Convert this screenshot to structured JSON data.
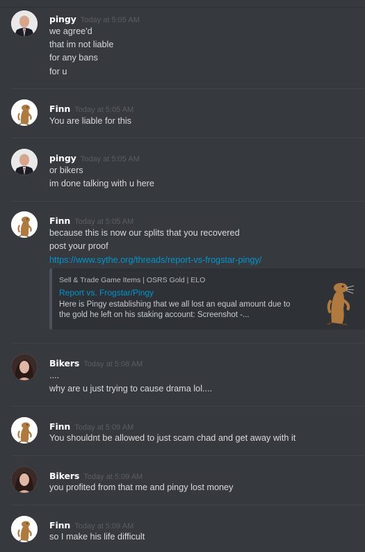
{
  "messages": [
    {
      "author": "pingy",
      "avatar_icon": "man-in-suit-avatar",
      "timestamp": "Today at 5:05 AM",
      "lines": [
        "we agree'd",
        "that im not liable",
        "for any bans",
        "for u"
      ]
    },
    {
      "author": "Finn",
      "avatar_icon": "otter-avatar",
      "timestamp": "Today at 5:05 AM",
      "lines": [
        "You are liable for this"
      ]
    },
    {
      "author": "pingy",
      "avatar_icon": "man-in-suit-avatar",
      "timestamp": "Today at 5:05 AM",
      "lines": [
        "or bikers",
        "im done talking with u here"
      ]
    },
    {
      "author": "Finn",
      "avatar_icon": "otter-avatar",
      "timestamp": "Today at 5:05 AM",
      "lines": [
        "because this is now our splits that you recovered",
        "post your proof"
      ],
      "link": "https://www.sythe.org/threads/report-vs-frogstar-pingy/",
      "embed": {
        "provider": "Sell & Trade Game Items | OSRS Gold | ELO",
        "title": "Report vs. Frogstar/Pingy",
        "description": "Here is Pingy establishing that we all lost an equal amount due to the gold he left on his staking account: Screenshot -...",
        "thumbnail_icon": "otter-thumbnail"
      }
    },
    {
      "author": "Bikers",
      "avatar_icon": "woman-avatar",
      "timestamp": "Today at 5:08 AM",
      "lines": [
        "....",
        "why are u just trying to cause drama lol...."
      ]
    },
    {
      "author": "Finn",
      "avatar_icon": "otter-avatar",
      "timestamp": "Today at 5:09 AM",
      "lines": [
        "You shouldnt be allowed to just scam chad and get away with it"
      ]
    },
    {
      "author": "Bikers",
      "avatar_icon": "woman-avatar",
      "timestamp": "Today at 5:09 AM",
      "lines": [
        "you profited from that me and pingy lost money"
      ]
    },
    {
      "author": "Finn",
      "avatar_icon": "otter-avatar",
      "timestamp": "Today at 5:09 AM",
      "lines": [
        "so I make his life difficult"
      ]
    }
  ],
  "colors": {
    "background": "#36393e",
    "username": "#ffffff",
    "timestamp": "#5b5e64",
    "text": "#d8d9da",
    "link": "#0096cf",
    "embed_bg": "#2e3136",
    "embed_border": "#4f545c"
  }
}
